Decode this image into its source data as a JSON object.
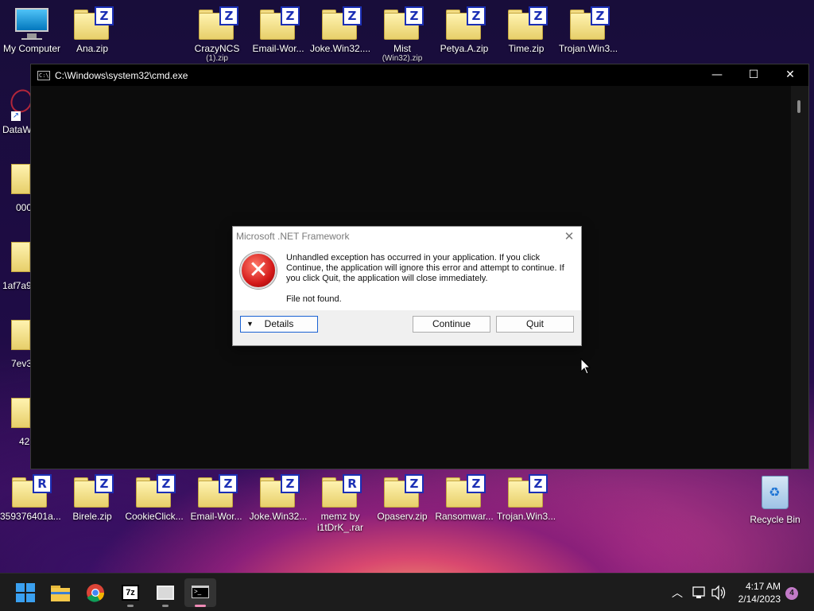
{
  "desktop": {
    "top_icons": [
      {
        "label": "My Computer",
        "type": "computer"
      },
      {
        "label": "Ana.zip",
        "badge": "Z"
      },
      {
        "label": "CrazyNCS",
        "sub": "(1).zip",
        "badge": "Z"
      },
      {
        "label": "Email-Wor...",
        "badge": "Z"
      },
      {
        "label": "Joke.Win32....",
        "badge": "Z"
      },
      {
        "label": "Mist",
        "sub": "(Win32).zip",
        "badge": "Z"
      },
      {
        "label": "Petya.A.zip",
        "badge": "Z"
      },
      {
        "label": "Time.zip",
        "badge": "Z"
      },
      {
        "label": "Trojan.Win3...",
        "badge": "Z"
      }
    ],
    "left_icons": [
      {
        "label": "DataW"
      },
      {
        "label": "000"
      },
      {
        "label": "1af7a9("
      },
      {
        "label": "7ev3"
      },
      {
        "label": "42."
      }
    ],
    "bottom_icons": [
      {
        "label": "359376401a...",
        "badge": "R"
      },
      {
        "label": "Birele.zip",
        "badge": "Z"
      },
      {
        "label": "CookieClick...",
        "badge": "Z"
      },
      {
        "label": "Email-Wor...",
        "badge": "Z"
      },
      {
        "label": "Joke.Win32...",
        "badge": "Z"
      },
      {
        "label": "memz by",
        "sub": "i1tDrK_.rar",
        "badge": "R"
      },
      {
        "label": "Opaserv.zip",
        "badge": "Z"
      },
      {
        "label": "Ransomwar...",
        "badge": "Z"
      },
      {
        "label": "Trojan.Win3...",
        "badge": "Z"
      }
    ],
    "recycle_bin": "Recycle Bin"
  },
  "cmd_window": {
    "title": "C:\\Windows\\system32\\cmd.exe",
    "icon_text": "C:\\",
    "minimize": "—",
    "maximize": "☐",
    "close": "✕"
  },
  "dialog": {
    "title": "Microsoft .NET Framework",
    "close": "✕",
    "message": "Unhandled exception has occurred in your application. If you click Continue, the application will ignore this error and attempt to continue. If you click Quit, the application will close immediately.",
    "detail": "File not found.",
    "details_button": "Details",
    "continue_button": "Continue",
    "quit_button": "Quit"
  },
  "taskbar": {
    "apps": [
      "start",
      "file-explorer",
      "chrome",
      "7zip",
      "window",
      "cmd"
    ],
    "time": "4:17 AM",
    "date": "2/14/2023",
    "notifications": "4"
  }
}
